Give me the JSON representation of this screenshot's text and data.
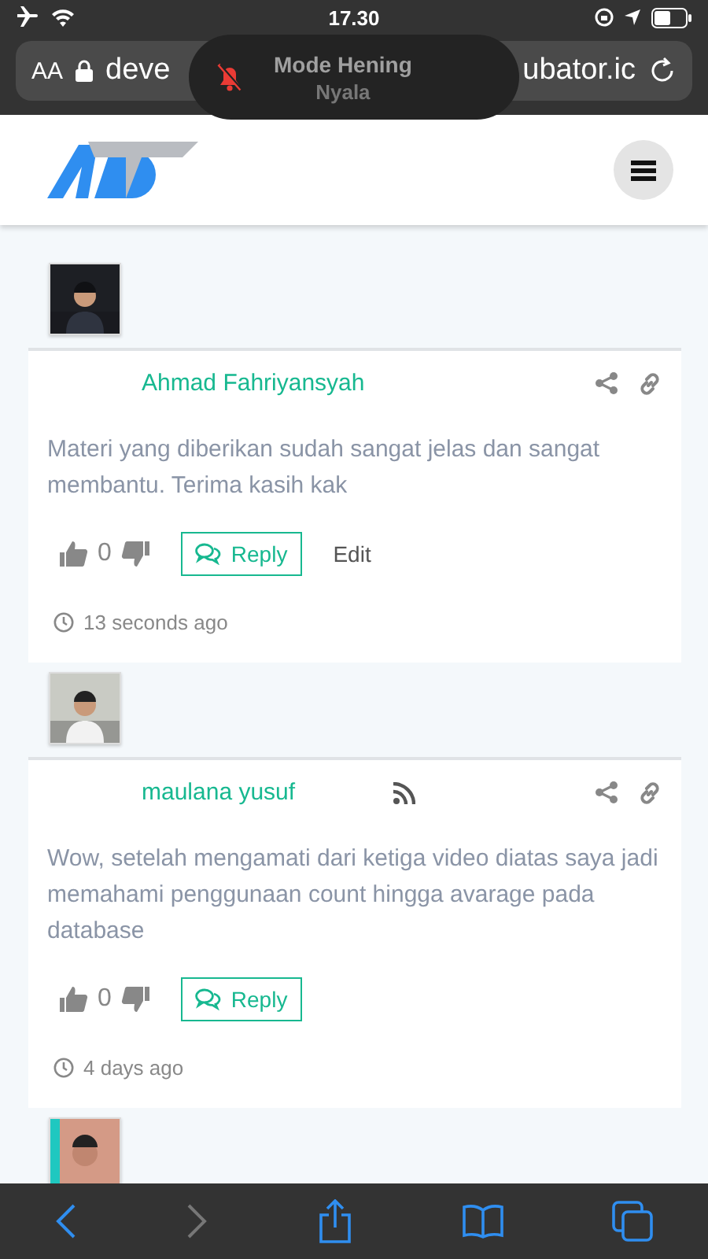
{
  "status_bar": {
    "time": "17.30"
  },
  "address_bar": {
    "text_size": "AA",
    "url_start": "deve",
    "url_end": "ubator.ic"
  },
  "toast": {
    "title": "Mode Hening",
    "subtitle": "Nyala"
  },
  "comments": [
    {
      "author": "Ahmad Fahriyansyah",
      "rss": false,
      "body": "Materi yang diberikan sudah sangat jelas dan sangat membantu. Terima kasih kak",
      "votes": "0",
      "reply": "Reply",
      "edit": "Edit",
      "time": "13 seconds ago"
    },
    {
      "author": "maulana yusuf",
      "rss": true,
      "body": "Wow, setelah mengamati dari ketiga video diatas saya jadi memahami penggunaan count hingga avarage pada database",
      "votes": "0",
      "reply": "Reply",
      "time": "4 days ago"
    }
  ]
}
